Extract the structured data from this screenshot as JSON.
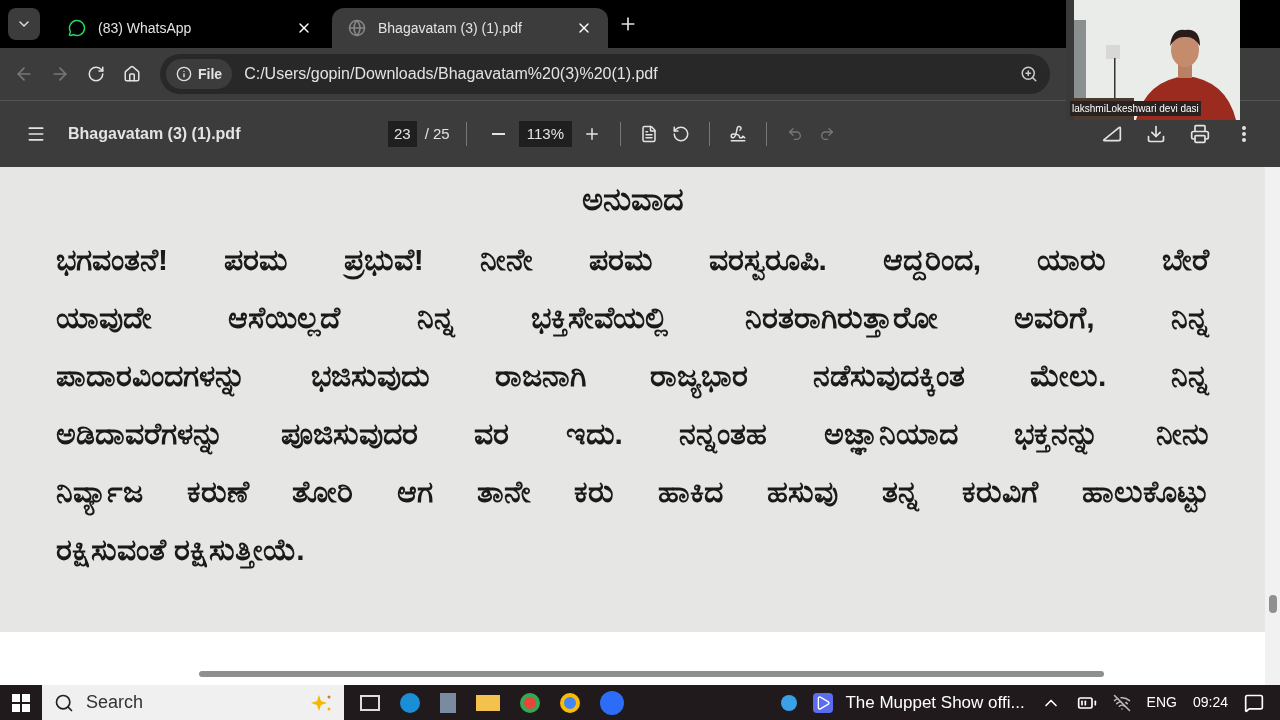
{
  "tabs": [
    {
      "title": "(83) WhatsApp",
      "selected": false
    },
    {
      "title": "Bhagavatam (3) (1).pdf",
      "selected": true
    }
  ],
  "address_bar": {
    "scheme_chip": "File",
    "url": "C:/Users/gopin/Downloads/Bhagavatam%20(3)%20(1).pdf"
  },
  "pdf_toolbar": {
    "title": "Bhagavatam (3) (1).pdf",
    "page": "23",
    "page_total": "/ 25",
    "zoom": "113%"
  },
  "document": {
    "heading": "ಅನುವಾದ",
    "lines": [
      "ಭಗವಂತನೆ! ಪರಮ ಪ್ರಭುವೆ! ನೀನೇ ಪರಮ ವರಸ್ವರೂಪಿ. ಆದ್ದರಿಂದ, ಯಾರು ಬೇರೆ",
      "ಯಾವುದೇ ಆಸೆಯಿಲ್ಲದೆ ನಿನ್ನ ಭಕ್ತಿಸೇವೆಯಲ್ಲಿ ನಿರತರಾಗಿರುತ್ತಾರೋ ಅವರಿಗೆ, ನಿನ್ನ",
      "ಪಾದಾರವಿಂದಗಳನ್ನು ಭಜಿಸುವುದು ರಾಜನಾಗಿ ರಾಜ್ಯಭಾರ ನಡೆಸುವುದಕ್ಕಿಂತ ಮೇಲು. ನಿನ್ನ",
      "ಅಡಿದಾವರೆಗಳನ್ನು ಪೂಜಿಸುವುದರ ವರ ಇದು. ನನ್ನಂತಹ ಅಜ್ಞಾನಿಯಾದ ಭಕ್ತನನ್ನು ನೀನು",
      "ನಿರ್ವ್ಯಾಜ ಕರುಣೆ ತೋರಿ ಆಗ ತಾನೇ ಕರು ಹಾಕಿದ ಹಸುವು ತನ್ನ ಕರುವಿಗೆ ಹಾಲುಕೊಟ್ಟು",
      "ರಕ್ಷಿಸುವಂತೆ ರಕ್ಷಿಸುತ್ತೀಯೆ."
    ]
  },
  "video_overlay": {
    "kind": "picture",
    "participant_name": "lakshmiLokeshwari devi dasi"
  },
  "taskbar": {
    "search_placeholder": "Search",
    "media_title": "The Muppet Show offi...",
    "language": "ENG",
    "time": "09:24"
  }
}
